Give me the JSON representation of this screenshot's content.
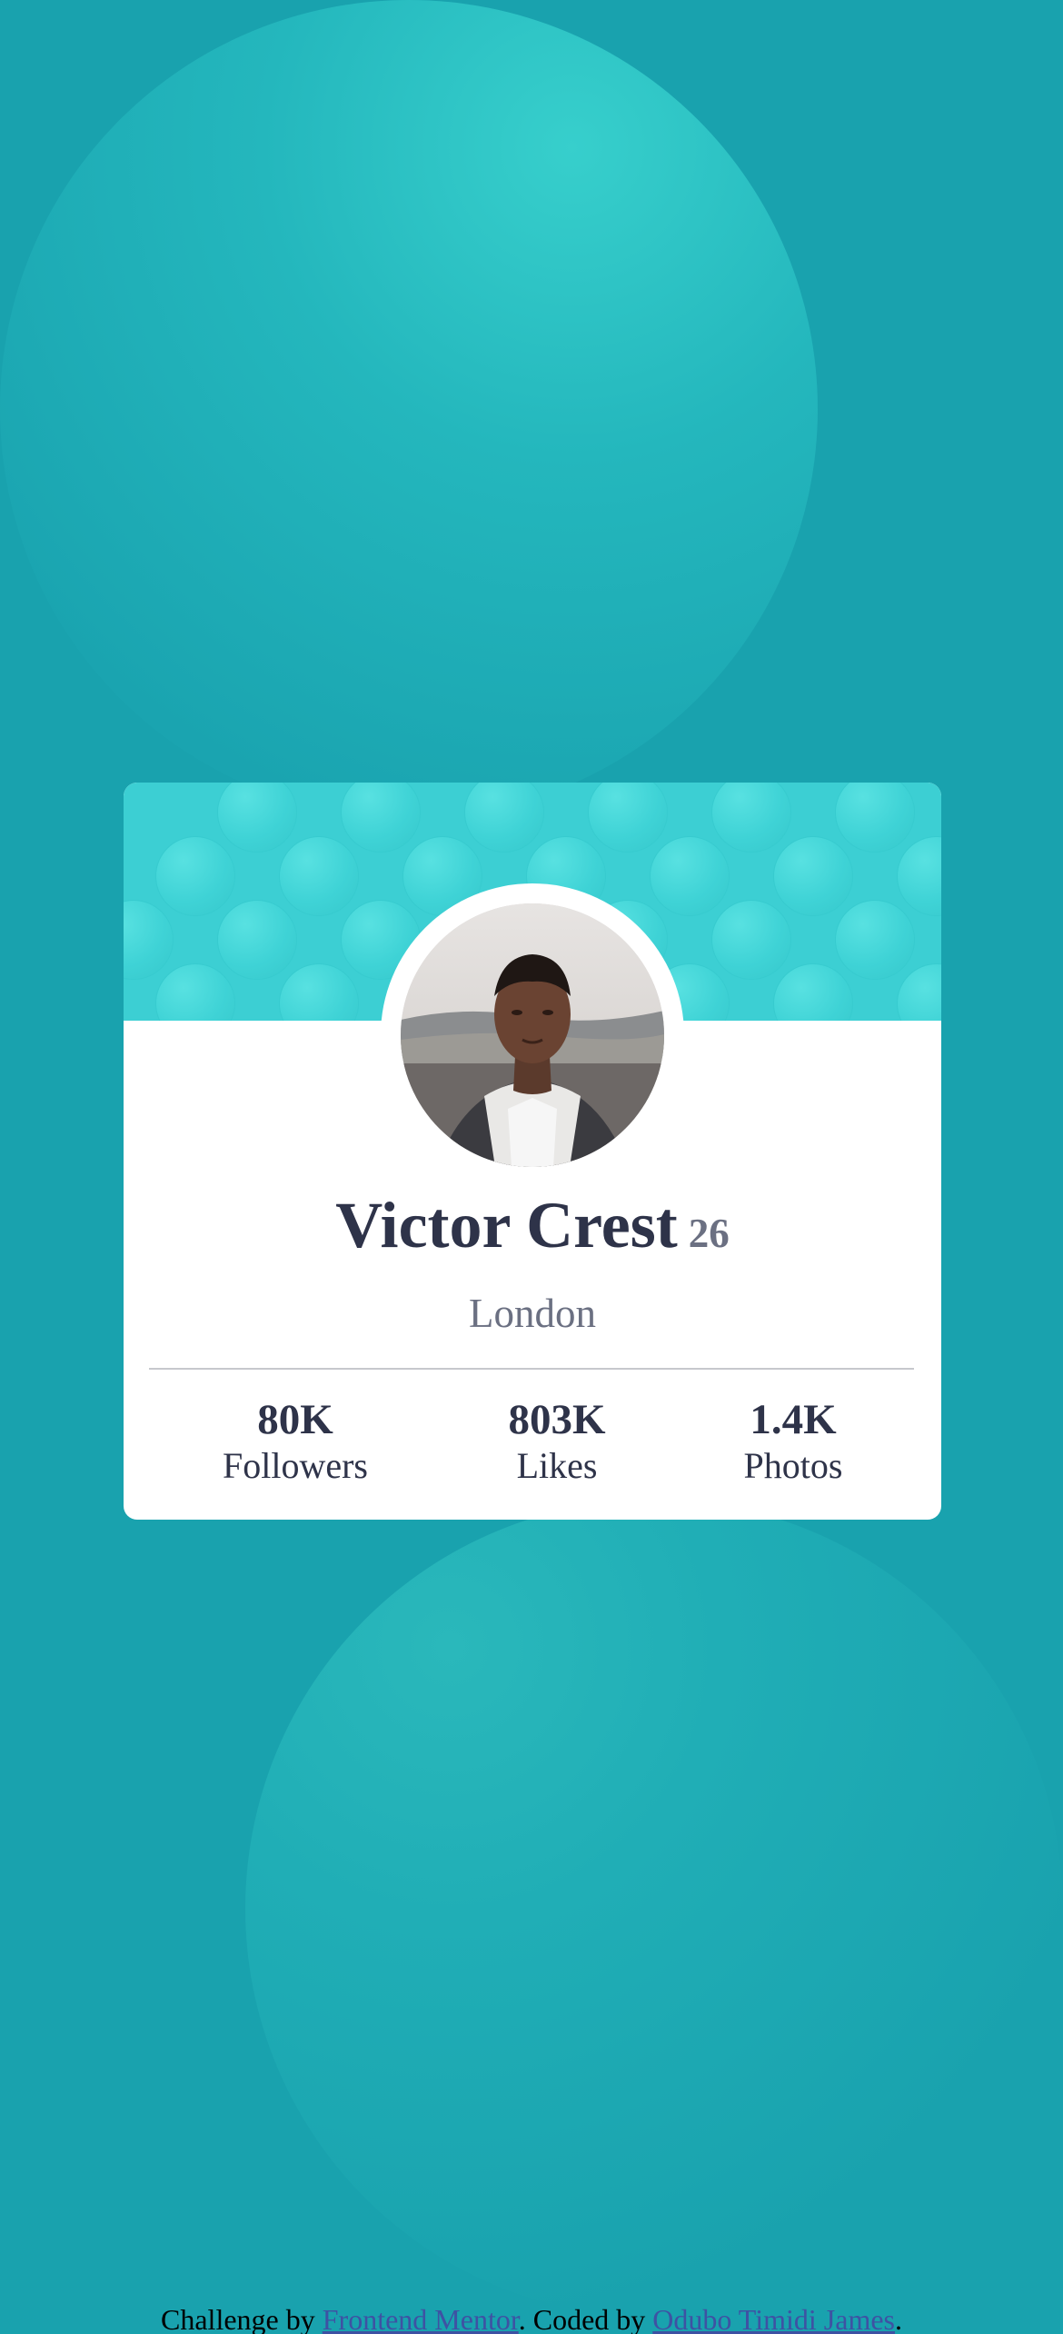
{
  "profile": {
    "name": "Victor Crest",
    "age": "26",
    "city": "London"
  },
  "stats": [
    {
      "value": "80K",
      "label": "Followers"
    },
    {
      "value": "803K",
      "label": "Likes"
    },
    {
      "value": "1.4K",
      "label": "Photos"
    }
  ],
  "footer": {
    "prefix": "Challenge by ",
    "link1": "Frontend Mentor",
    "middle": ". Coded by ",
    "link2": "Odubo Timidi James",
    "suffix": "."
  },
  "colors": {
    "background": "#19a2ae",
    "card_header": "#3ccfd3",
    "text_dark": "#2e3349",
    "text_muted": "#6b7082",
    "link": "#3e52a3"
  }
}
